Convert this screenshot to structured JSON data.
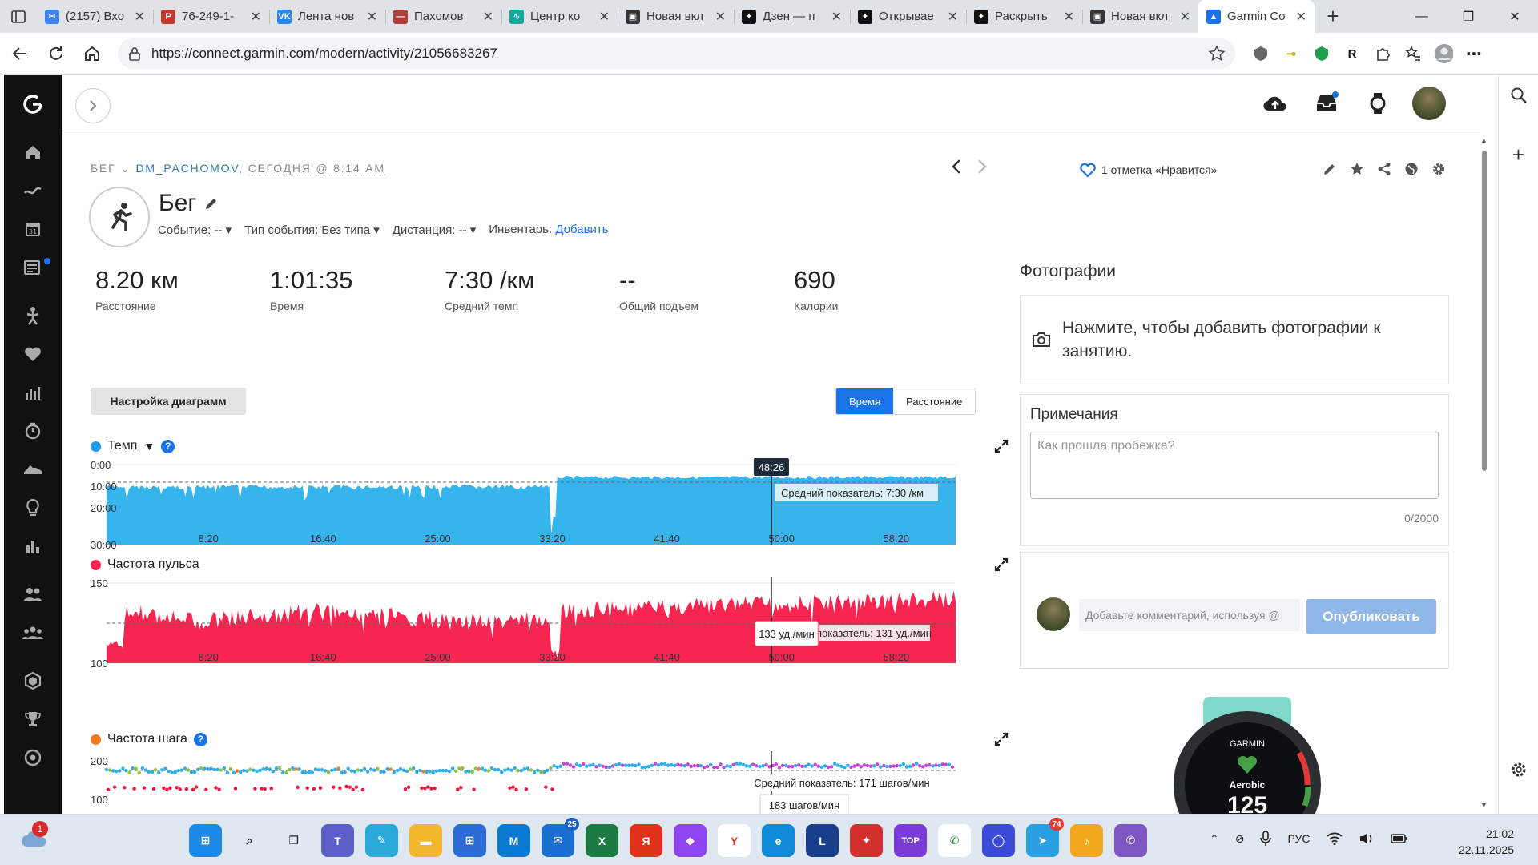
{
  "browser": {
    "tabs": [
      {
        "title": "(2157) Вхо",
        "color": "#3b82f6",
        "glyph": "✉"
      },
      {
        "title": "76-249-1-",
        "color": "#c0392b",
        "glyph": "P"
      },
      {
        "title": "Лента нов",
        "color": "#2787f5",
        "glyph": "VK"
      },
      {
        "title": "Пахомов",
        "color": "#b23b3b",
        "glyph": "—"
      },
      {
        "title": "Центр ко",
        "color": "#13a89e",
        "glyph": "∿"
      },
      {
        "title": "Новая вкл",
        "color": "#333333",
        "glyph": "▣"
      },
      {
        "title": "Дзен — п",
        "color": "#111111",
        "glyph": "✦"
      },
      {
        "title": "Открывае",
        "color": "#111111",
        "glyph": "✦"
      },
      {
        "title": "Раскрыть",
        "color": "#111111",
        "glyph": "✦"
      },
      {
        "title": "Новая вкл",
        "color": "#333333",
        "glyph": "▣"
      },
      {
        "title": "Garmin Co",
        "color": "#1a73e8",
        "glyph": "▲"
      }
    ],
    "url": "https://connect.garmin.com/modern/activity/21056683267"
  },
  "activity": {
    "breadcrumb_type": "БЕГ",
    "breadcrumb_user": "DM_PACHOMOV",
    "breadcrumb_date": "СЕГОДНЯ @ 8:14 AM",
    "likes": "1 отметка «Нравится»",
    "title": "Бег",
    "meta": {
      "event": "Событие: --",
      "event_type": "Тип события: Без типа",
      "distance": "Дистанция: --",
      "gear_label": "Инвентарь:",
      "gear_link": "Добавить"
    },
    "stats": [
      {
        "value": "8.20 км",
        "label": "Расстояние"
      },
      {
        "value": "1:01:35",
        "label": "Время"
      },
      {
        "value": "7:30 /км",
        "label": "Средний темп"
      },
      {
        "value": "--",
        "label": "Общий подъем"
      },
      {
        "value": "690",
        "label": "Калории"
      }
    ]
  },
  "charts_ui": {
    "settings_button": "Настройка диаграмм",
    "toggle_time": "Время",
    "toggle_distance": "Расстояние",
    "x_ticks": [
      "8:20",
      "16:40",
      "25:00",
      "33:20",
      "41:40",
      "50:00",
      "58:20"
    ],
    "cursor_label": "48:26"
  },
  "chart_data": [
    {
      "type": "area",
      "title": "Темп",
      "series_color": "#36b4ec",
      "y_ticks": [
        "0:00",
        "10:00",
        "20:00",
        "30:00"
      ],
      "avg_label": "Средний показатель: 7:30 /км",
      "x": [
        "8:20",
        "16:40",
        "25:00",
        "33:20",
        "41:40",
        "50:00",
        "58:20"
      ]
    },
    {
      "type": "area",
      "title": "Частота пульса",
      "series_color": "#f7254f",
      "y_ticks": [
        "150",
        "100"
      ],
      "avg_label": "Средний показатель: 131 уд./мин",
      "tooltip": "133 уд./мин",
      "x": [
        "8:20",
        "16:40",
        "25:00",
        "33:20",
        "41:40",
        "50:00",
        "58:20"
      ]
    },
    {
      "type": "scatter",
      "title": "Частота шага",
      "series_color": "#f47a20",
      "y_ticks": [
        "200",
        "100"
      ],
      "avg_label": "Средний показатель: 171 шагов/мин",
      "tooltip": "183 шагов/мин"
    }
  ],
  "right_panel": {
    "photos_title": "Фотографии",
    "photos_prompt": "Нажмите, чтобы добавить фотографии к занятию.",
    "notes_title": "Примечания",
    "notes_placeholder": "Как прошла пробежка?",
    "notes_count": "0/2000",
    "comment_placeholder": "Добавьте комментарий, используя @",
    "publish_label": "Опубликовать",
    "watch_brand": "GARMIN",
    "watch_mode": "Aerobic",
    "watch_value": "125"
  },
  "taskbar": {
    "weather_badge": "1",
    "ms365_badge": "25",
    "telegram_badge": "74",
    "language": "РУС",
    "time": "21:02",
    "date": "22.11.2025"
  }
}
